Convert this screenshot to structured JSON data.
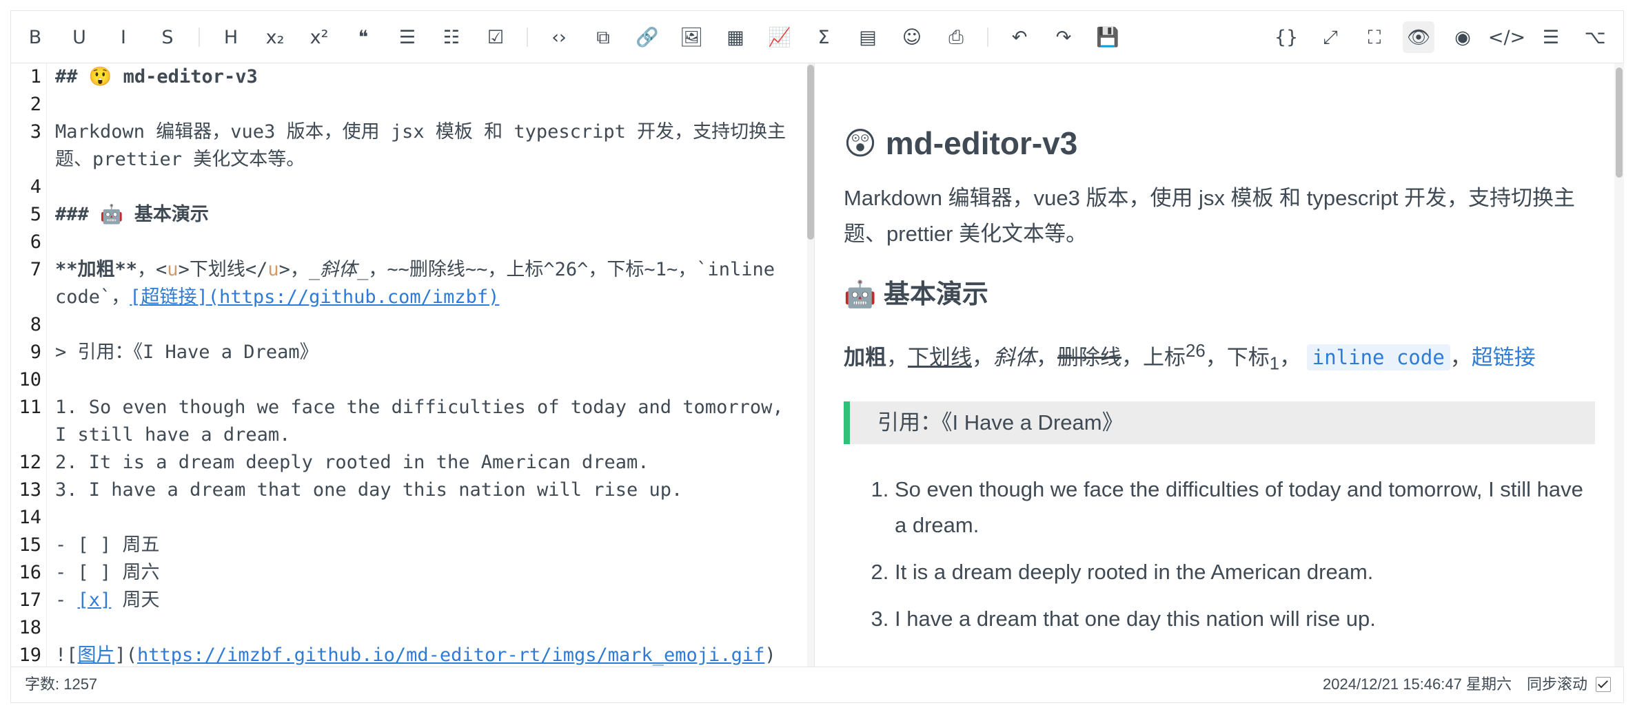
{
  "toolbar": {
    "left": [
      {
        "name": "bold-icon",
        "glyph": "B"
      },
      {
        "name": "underline-icon",
        "glyph": "U"
      },
      {
        "name": "italic-icon",
        "glyph": "I"
      },
      {
        "name": "strikethrough-icon",
        "glyph": "S"
      },
      {
        "name": "title-icon",
        "glyph": "H"
      },
      {
        "name": "subscript-icon",
        "glyph": "x₂"
      },
      {
        "name": "superscript-icon",
        "glyph": "x²"
      },
      {
        "name": "quote-icon",
        "glyph": "❝"
      },
      {
        "name": "unordered-list-icon",
        "glyph": "☰"
      },
      {
        "name": "ordered-list-icon",
        "glyph": "☷"
      },
      {
        "name": "task-list-icon",
        "glyph": "☑"
      },
      {
        "name": "inline-code-icon",
        "glyph": "‹›"
      },
      {
        "name": "code-block-icon",
        "glyph": "⧉"
      },
      {
        "name": "link-icon",
        "glyph": "🔗"
      },
      {
        "name": "image-icon",
        "glyph": "🖼"
      },
      {
        "name": "table-icon",
        "glyph": "▦"
      },
      {
        "name": "chart-icon",
        "glyph": "📈"
      },
      {
        "name": "formula-icon",
        "glyph": "Σ"
      },
      {
        "name": "catalog-icon",
        "glyph": "▤"
      },
      {
        "name": "emoji-icon",
        "glyph": "☺"
      },
      {
        "name": "export-pdf-icon",
        "glyph": "⎙"
      },
      {
        "name": "undo-icon",
        "glyph": "↶"
      },
      {
        "name": "redo-icon",
        "glyph": "↷"
      },
      {
        "name": "save-icon",
        "glyph": "💾"
      }
    ],
    "right": [
      {
        "name": "format-code-icon",
        "glyph": "{}"
      },
      {
        "name": "fullscreen-icon",
        "glyph": "⤢"
      },
      {
        "name": "page-fullscreen-icon",
        "glyph": "⛶"
      },
      {
        "name": "preview-icon",
        "glyph": "👁"
      },
      {
        "name": "html-preview-icon",
        "glyph": "◉"
      },
      {
        "name": "source-code-icon",
        "glyph": "</>"
      },
      {
        "name": "toc-icon",
        "glyph": "☰"
      },
      {
        "name": "github-icon",
        "glyph": "⌥"
      }
    ]
  },
  "source": {
    "l1_prefix": "## ",
    "l1_emoji": "😲",
    "l1_text": " md-editor-v3",
    "l3": "Markdown 编辑器，vue3 版本，使用 jsx 模板 和 typescript 开发，支持切换主题、prettier 美化文本等。",
    "l5_prefix": "### ",
    "l5_emoji": "🤖",
    "l5_text": " 基本演示",
    "l7_bold": "**加粗**",
    "l7_a": "，<",
    "l7_u1": "u",
    "l7_b": ">下划线</",
    "l7_u2": "u",
    "l7_c": ">，",
    "l7_italic": "_斜体_",
    "l7_d": "，~~删除线~~，上标^26^，下标~1~，`inline code`，",
    "l7_link_text": "[超链接]",
    "l7_link_url": "(https://github.com/imzbf)",
    "l9": "> 引用：《I Have a Dream》",
    "l11": "1. So even though we face the difficulties of today and tomorrow, I still have a dream.",
    "l12": "2. It is a dream deeply rooted in the American dream.",
    "l13": "3. I have a dream that one day this nation will rise up.",
    "l15": "- [ ] 周五",
    "l16": "- [ ] 周六",
    "l17_a": "- ",
    "l17_box": "[x]",
    "l17_b": " 周天",
    "l19_a": "![",
    "l19_img": "图片",
    "l19_b": "](",
    "l19_url": "https://imzbf.github.io/md-editor-rt/imgs/mark_emoji.gif",
    "l19_c": ")"
  },
  "line_numbers": [
    "1",
    "2",
    "3",
    "4",
    "5",
    "6",
    "7",
    "8",
    "9",
    "10",
    "11",
    "12",
    "13",
    "14",
    "15",
    "16",
    "17",
    "18",
    "19"
  ],
  "preview": {
    "h2_emoji": "😲",
    "h2_text": "md-editor-v3",
    "p1": "Markdown 编辑器，vue3 版本，使用 jsx 模板 和 typescript 开发，支持切换主题、prettier 美化文本等。",
    "h3_emoji": "🤖",
    "h3_text": "基本演示",
    "bold": "加粗",
    "sep": "，",
    "underline": "下划线",
    "italic": "斜体",
    "strike": "删除线",
    "sup_label": "上标",
    "sup_val": "26",
    "sub_label": "下标",
    "sub_val": "1",
    "code": "inline code",
    "link": "超链接",
    "quote": "引用：《I Have a Dream》",
    "list": [
      "So even though we face the difficulties of today and tomorrow, I still have a dream.",
      "It is a dream deeply rooted in the American dream.",
      "I have a dream that one day this nation will rise up."
    ]
  },
  "footer": {
    "word_count": "字数: 1257",
    "datetime": "2024/12/21 15:46:47 星期六",
    "sync_scroll": "同步滚动"
  }
}
